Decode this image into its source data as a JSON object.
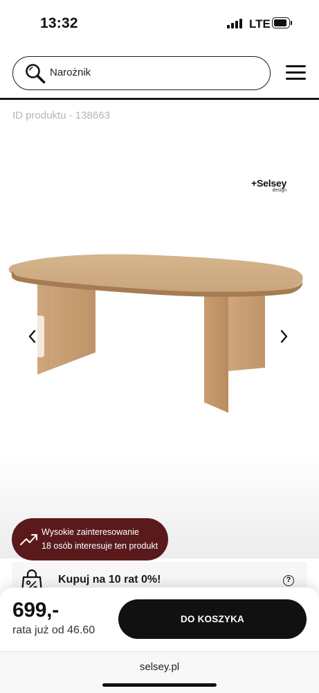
{
  "status_bar": {
    "time": "13:32",
    "network": "LTE",
    "icons": [
      "signal-bars-icon",
      "battery-icon"
    ]
  },
  "header": {
    "search": {
      "value": "Narożnik",
      "icon": "search-icon"
    },
    "menu_icon": "hamburger-menu-icon"
  },
  "product": {
    "id_label": "ID produktu - 138663"
  },
  "gallery": {
    "brand_name": "+Selsey",
    "brand_sub": "design",
    "image": "oval-wooden-dining-table-photo",
    "prev_icon": "chevron-left-icon",
    "next_icon": "chevron-right-icon"
  },
  "interest_badge": {
    "icon": "trending-up-icon",
    "title": "Wysokie zainteresowanie",
    "subtitle": "18 osób interesuje ten produkt",
    "color": "#5a1a1c"
  },
  "installments": {
    "icon": "shopping-bag-percent-icon",
    "label": "Kupuj na 10 rat 0%!",
    "help_icon": "question-circle-icon",
    "help_glyph": "?"
  },
  "purchase": {
    "price": "699,-",
    "installment_text": "rata już od 46.60",
    "cart_button": "DO KOSZYKA",
    "cart_button_color": "#111111"
  },
  "browser": {
    "url": "selsey.pl"
  }
}
